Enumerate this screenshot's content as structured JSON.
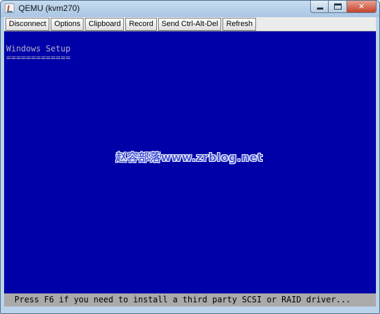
{
  "window": {
    "title": "QEMU (kvm270)",
    "icon": "java-app-icon",
    "controls": {
      "minimize": "minimize-icon",
      "maximize": "maximize-icon",
      "close": "close-icon"
    }
  },
  "toolbar": {
    "buttons": [
      {
        "label": "Disconnect"
      },
      {
        "label": "Options"
      },
      {
        "label": "Clipboard"
      },
      {
        "label": "Record"
      },
      {
        "label": "Send Ctrl-Alt-Del"
      },
      {
        "label": "Refresh"
      }
    ]
  },
  "screen": {
    "title": "Windows Setup",
    "underline": "=============",
    "watermark": "赵容部落www.zrblog.net",
    "status": "Press F6 if you need to install a third party SCSI or RAID driver...",
    "colors": {
      "background": "#0000a8",
      "text": "#b0b0c8",
      "status_bar": "#aaaaaa"
    }
  }
}
